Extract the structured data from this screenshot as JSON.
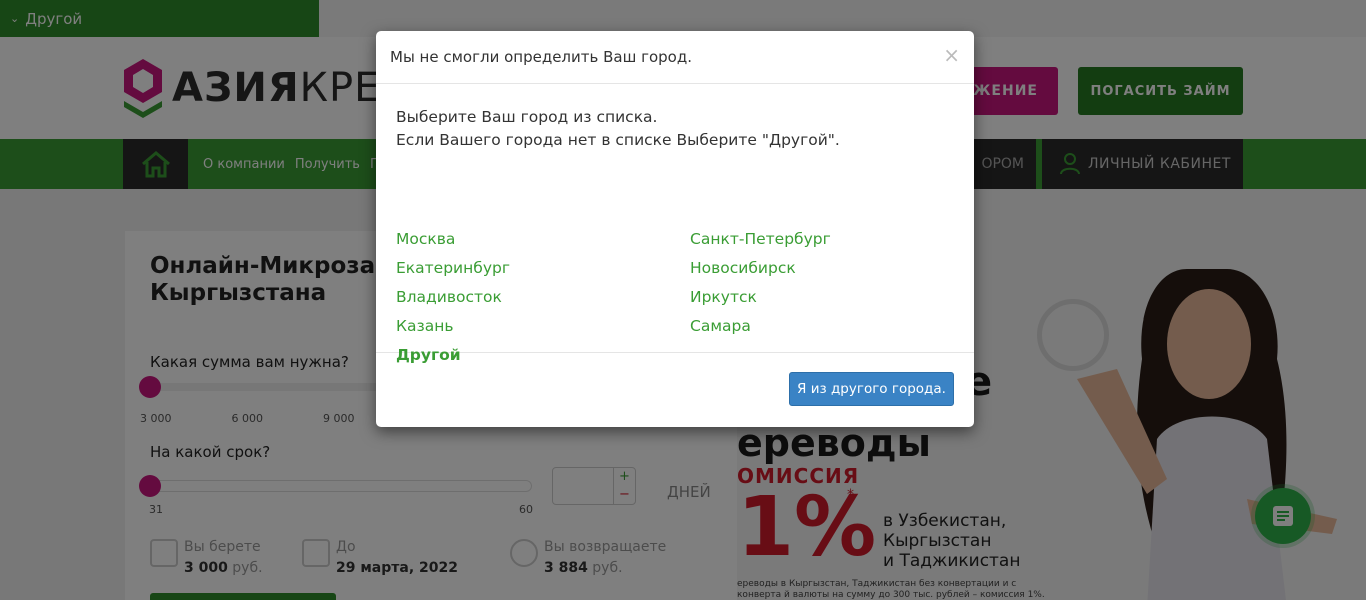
{
  "topbar": {
    "city_selector": "Другой"
  },
  "header": {
    "logo_text_bold": "АЗИЯ",
    "logo_text_tail": "КРЕ",
    "apply_button": "ОЖЕНИЕ",
    "repay_button": "ПОГАСИТЬ ЗАЙМ",
    "brand_colors": {
      "green": "#3a9d34",
      "magenta": "#c8167f",
      "dark": "#2b2b2b"
    }
  },
  "nav": {
    "links": [
      "О компании",
      "Получить",
      "По"
    ],
    "partner_tab": "ОРОМ",
    "cabinet_tab": "ЛИЧНЫЙ КАБИНЕТ"
  },
  "calculator": {
    "title": "Онлайн-Микроза Узбекистана, Тад Кыргызстана",
    "amount_question": "Какая сумма вам нужна?",
    "amount_ticks": [
      "3 000",
      "6 000",
      "9 000"
    ],
    "term_question": "На какой срок?",
    "term_min": "31",
    "term_max": "60",
    "days_label": "ДНЕЙ",
    "stepper_plus": "+",
    "stepper_minus": "−",
    "take_label": "Вы берете",
    "take_value": "3 000",
    "take_unit": "руб.",
    "until_label": "До",
    "until_value": "29 марта, 2022",
    "return_label": "Вы возвращаете",
    "return_value": "3 884",
    "return_unit": "руб."
  },
  "banner": {
    "headline_partial": "е",
    "headline": "ереводы",
    "commission": "ОМИССИЯ",
    "percent": "1%",
    "asterisk": "*",
    "destinations": [
      "в Узбекистан,",
      "Кыргызстан",
      "и Таджикистан"
    ],
    "fine_print": "ереводы в Кыргызстан, Таджикистан без конвертации и с конверта й валюты на сумму до 300 тыс. рублей – комиссия 1%. На переводы"
  },
  "modal": {
    "title": "Мы не смогли определить Ваш город.",
    "close_symbol": "×",
    "instruction_line1": "Выберите Ваш город из списка.",
    "instruction_line2": "Если Вашего города нет в списке Выберите \"Другой\".",
    "cities_left": [
      "Москва",
      "Екатеринбург",
      "Владивосток",
      "Казань"
    ],
    "cities_right": [
      "Санкт-Петербург",
      "Новосибирск",
      "Иркутск",
      "Самара"
    ],
    "other_city": "Другой",
    "other_city_button": "Я из другого города."
  }
}
